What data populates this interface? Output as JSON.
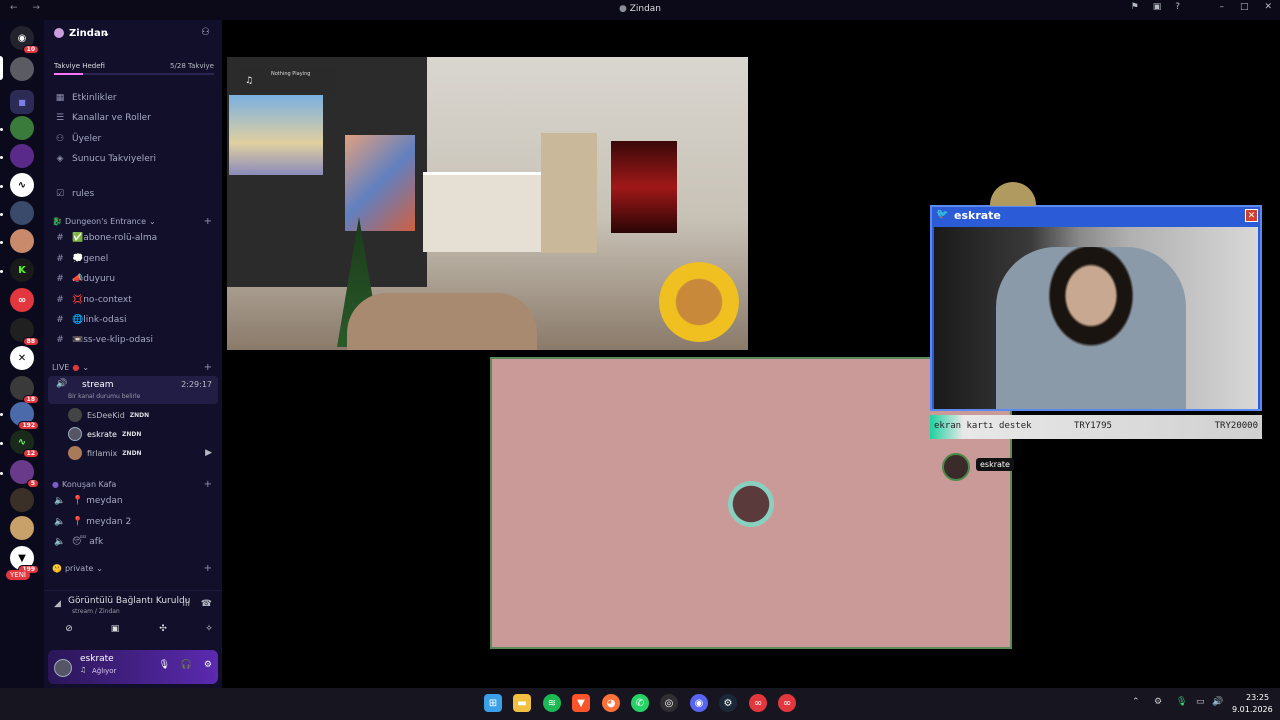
{
  "window": {
    "title": "Zindan",
    "nav_arrows": "←   →"
  },
  "rail": {
    "home_badge": "10",
    "badges": [
      "88",
      "18",
      "192",
      "12",
      "5",
      "199"
    ],
    "new_label": "YENİ"
  },
  "guild": {
    "name": "Zindan"
  },
  "boost": {
    "label": "Takviye Hedefi",
    "progress": "5/28 Takviye",
    "progress_fraction": 0.18
  },
  "nav_items": [
    {
      "label": "Etkinlikler"
    },
    {
      "label": "Kanallar ve Roller"
    },
    {
      "label": "Üyeler"
    },
    {
      "label": "Sunucu Takviyeleri"
    }
  ],
  "rules_channel": "rules",
  "categories": {
    "dungeon": "Dungeon's Entrance",
    "live": "LIVE",
    "konusan": "Konuşan Kafa",
    "private": "private"
  },
  "text_channels": [
    {
      "label": "✅abone-rolü-alma"
    },
    {
      "label": "💭genel"
    },
    {
      "label": "📣duyuru"
    },
    {
      "label": "💢no-context"
    },
    {
      "label": "🌐link-odasi"
    },
    {
      "label": "📼ss-ve-klip-odasi"
    }
  ],
  "stream_channel": {
    "name": "stream",
    "time": "2:29:17",
    "status": "Bir kanal durumu belirle"
  },
  "voice_users": [
    {
      "name": "EsDeeKid",
      "tag": "ZNDN"
    },
    {
      "name": "eskrate",
      "tag": "ZNDN"
    },
    {
      "name": "firlamix",
      "tag": "ZNDN"
    }
  ],
  "voice_channels": [
    {
      "label": "📍 meydan"
    },
    {
      "label": "📍 meydan 2"
    },
    {
      "label": "😴 afk"
    }
  ],
  "voice_connection": {
    "status": "Görüntülü Bağlantı Kuruldu",
    "sub": "stream / Zindan"
  },
  "user": {
    "name": "eskrate",
    "status": "Ağlıyor"
  },
  "stage": {
    "music_label": "Nothing Playing",
    "overlay_window_title": "eskrate",
    "ticker": {
      "left": "ekran kartı destek",
      "mid": "TRY1795",
      "right": "TRY20000"
    },
    "tooltip_name": "eskrate"
  },
  "clock": {
    "time": "23:25",
    "date": "9.01.2026"
  },
  "colors": {
    "sidebar": "#120f2b",
    "rail": "#0b0a1c",
    "accent": "#5865f2",
    "pink_canvas": "#c99a98",
    "danger": "#e2373e"
  }
}
